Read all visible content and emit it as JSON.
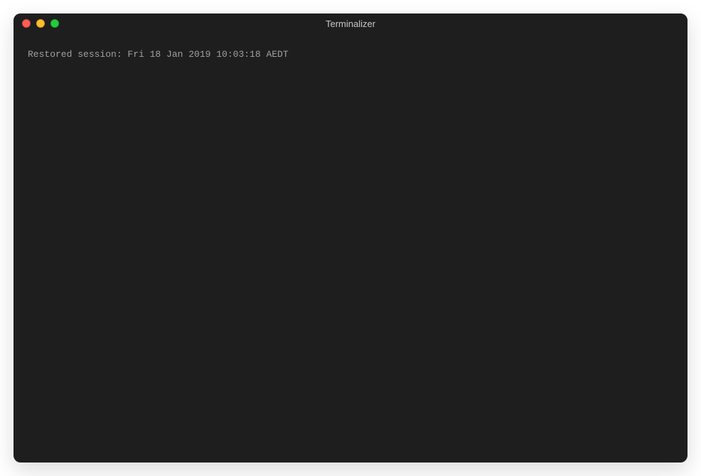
{
  "window": {
    "title": "Terminalizer"
  },
  "terminal": {
    "lines": [
      "Restored session: Fri 18 Jan 2019 10:03:18 AEDT"
    ]
  }
}
